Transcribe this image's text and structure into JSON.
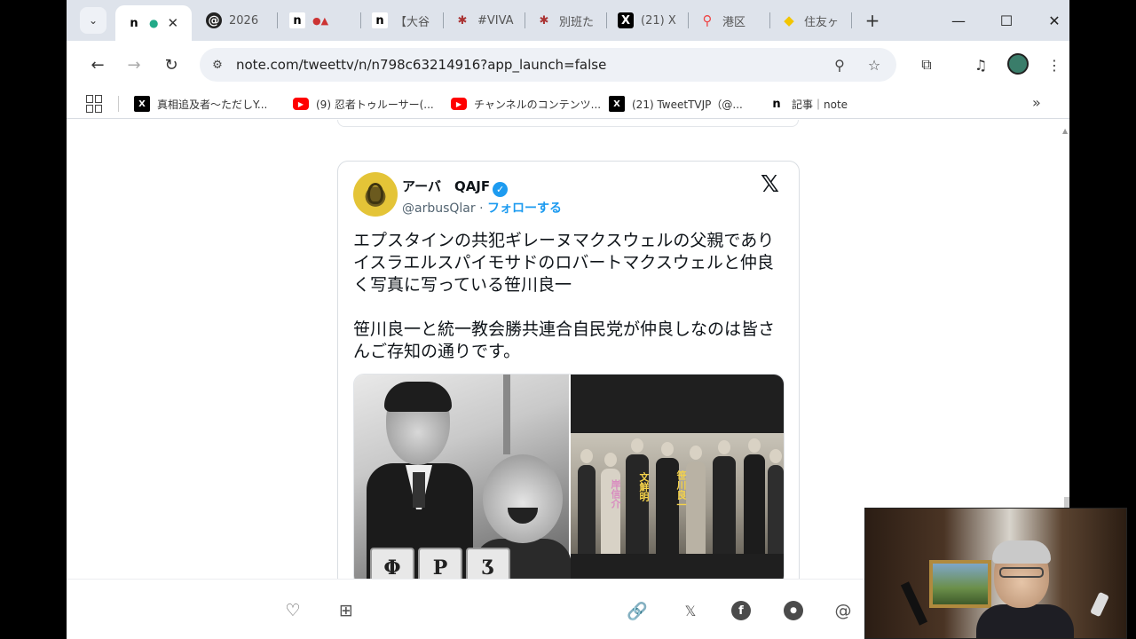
{
  "tabs": [
    {
      "title": "",
      "favicon": "n",
      "active": true
    },
    {
      "title": "2026",
      "favicon": "threads"
    },
    {
      "title": "",
      "favicon": "n"
    },
    {
      "title": "【大谷",
      "favicon": "n"
    },
    {
      "title": "#VIVA",
      "favicon": "paw"
    },
    {
      "title": "別班た",
      "favicon": "paw"
    },
    {
      "title": "(21) X",
      "favicon": "x"
    },
    {
      "title": "港区",
      "favicon": "maps"
    },
    {
      "title": "住友ヶ",
      "favicon": "diamond"
    }
  ],
  "toolbar": {
    "url": "note.com/tweettv/n/n798c63214916?app_launch=false"
  },
  "bookmarks": [
    {
      "label": "真相追及者～ただしY...",
      "icon": "x"
    },
    {
      "label": "(9) 忍者トゥルーサー(...",
      "icon": "youtube"
    },
    {
      "label": "チャンネルのコンテンツ...",
      "icon": "youtube"
    },
    {
      "label": "(21) TweetTVJP（@...",
      "icon": "x"
    },
    {
      "label": "記事｜note",
      "icon": "n"
    }
  ],
  "tweet": {
    "display_name": "アーバ　QAJF",
    "handle": "@arbusQlar",
    "separator": "·",
    "follow_label": "フォローする",
    "text_paragraph_1": "エプスタインの共犯ギレーヌマクスウェルの父親でありイスラエルスパイモサドのロバートマクスウェルと仲良く写真に写っている笹川良一",
    "text_paragraph_2": "笹川良一と統一教会勝共連合自民党が仲良しなのは皆さんご存知の通りです。",
    "image_blocks": [
      "Φ",
      "Ρ",
      "Ʒ"
    ],
    "image_overlay_1": "文鮮明",
    "image_overlay_2": "笹川良一",
    "image_overlay_3": "岸信介"
  },
  "action_bar": {
    "like_icon": "heart-icon",
    "save_icon": "bookmark-add-icon",
    "share_icons": [
      "link-icon",
      "x-icon",
      "facebook-icon",
      "line-icon",
      "threads-icon"
    ]
  },
  "colors": {
    "accent": "#1d9bf0",
    "tab_strip": "#dee3eb",
    "omnibox": "#eef1f6"
  }
}
